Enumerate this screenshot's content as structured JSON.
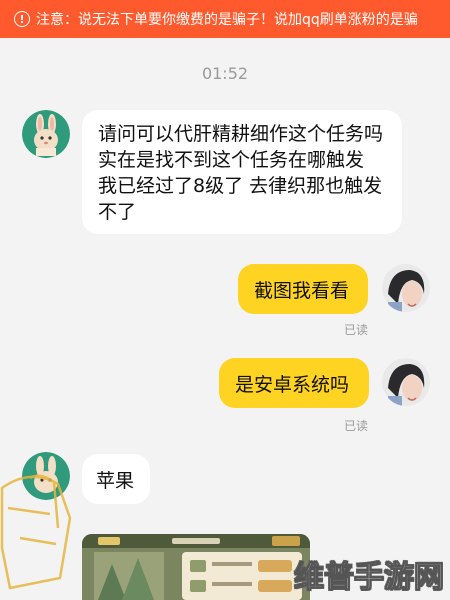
{
  "banner": {
    "icon": "warning-icon",
    "text": "注意：说无法下单要你缴费的是骗子！说加qq刷单涨粉的是骗",
    "color": "#ff5a2e"
  },
  "chat": {
    "timestamp": "01:52",
    "messages": [
      {
        "sender": "other",
        "text": "请问可以代肝精耕细作这个任务吗 实在是找不到这个任务在哪触发 我已经过了8级了 去律织那也触发不了"
      },
      {
        "sender": "me",
        "text": "截图我看看",
        "status": "已读"
      },
      {
        "sender": "me",
        "text": "是安卓系统吗",
        "status": "已读"
      },
      {
        "sender": "other",
        "text": "苹果"
      },
      {
        "sender": "other",
        "type": "image"
      }
    ]
  },
  "colors": {
    "my_bubble": "#ffd321",
    "their_bubble": "#ffffff",
    "background": "#f3f3f3"
  },
  "watermark": {
    "text": "维普手游网"
  }
}
